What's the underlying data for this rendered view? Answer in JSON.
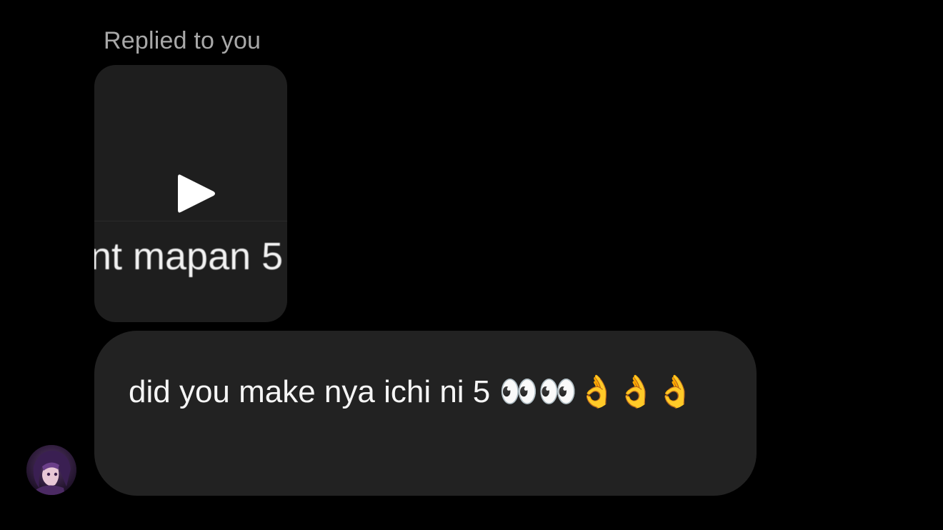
{
  "reply_header": {
    "label": "Replied to you"
  },
  "reply_preview": {
    "type": "video",
    "overlay_text": "nt mapan 5",
    "play_icon": "play-icon"
  },
  "message": {
    "text": "did you make nya ichi ni 5 👀👀👌👌👌"
  },
  "sender": {
    "avatar_icon": "avatar"
  },
  "colors": {
    "background": "#000000",
    "bubble": "#222222",
    "preview": "#1e1e1e",
    "label": "#a8a8a8",
    "text": "#f5f5f5"
  }
}
